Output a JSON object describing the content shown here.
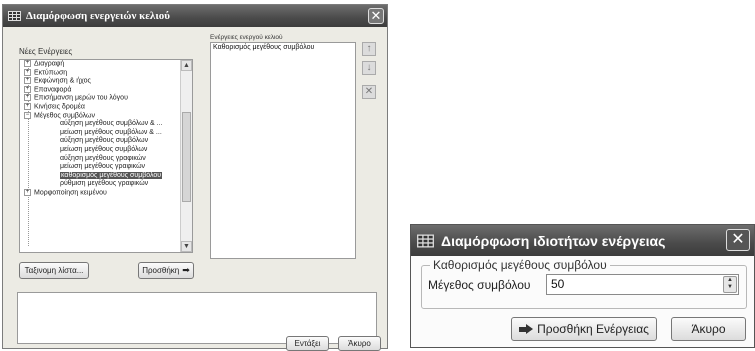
{
  "cell_actions_dialog": {
    "title": "Διαμόρφωση ενεργειών κελιού",
    "new_actions_label": "Νέες Ενέργειες",
    "tree_items": [
      {
        "label": "Διαγραφή",
        "level": 0
      },
      {
        "label": "Εκτύπωση",
        "level": 0
      },
      {
        "label": "Εκφώνηση & ήχος",
        "level": 0
      },
      {
        "label": "Επαναφορά",
        "level": 0
      },
      {
        "label": "Επισήμανση μερών του λόγου",
        "level": 0
      },
      {
        "label": "Κινήσεις δρομέα",
        "level": 0
      },
      {
        "label": "Μέγεθος συμβόλων",
        "level": 0
      },
      {
        "label": "αύξηση μεγέθους συμβόλων & ...",
        "level": 1
      },
      {
        "label": "μείωση μεγέθους συμβόλων & ...",
        "level": 1
      },
      {
        "label": "αύξηση μεγέθους συμβόλων",
        "level": 1
      },
      {
        "label": "μείωση μεγέθους συμβόλων",
        "level": 1
      },
      {
        "label": "αύξηση μεγέθους γραφικών",
        "level": 1
      },
      {
        "label": "μείωση μεγέθους γραφικών",
        "level": 1
      },
      {
        "label": "καθορισμός μεγέθους συμβόλου",
        "level": 1,
        "selected": true
      },
      {
        "label": "ρύθμιση μεγέθους γραφικών",
        "level": 1
      },
      {
        "label": "Μορφοποίηση κειμένου",
        "level": 0
      }
    ],
    "sort_button": "Ταξινομη λίστα...",
    "add_button": "Προσθήκη",
    "cell_actions_label": "Ενέργειες ενεργού κελιού",
    "cell_actions": [
      "Καθορισμός μεγέθους συμβόλου"
    ],
    "move_up_icon": "↑",
    "move_down_icon": "↓",
    "remove_icon": "✕",
    "ok_button": "Εντάξει",
    "cancel_button": "Άκυρο",
    "close_icon": "✕"
  },
  "action_props_dialog": {
    "title": "Διαμόρφωση ιδιοτήτων ενέργειας",
    "group_label": "Καθορισμός μεγέθους συμβόλου",
    "field_label": "Μέγεθος συμβόλου",
    "field_value": "50",
    "add_button": "Προσθήκη Ενέργειας",
    "cancel_button": "Άκυρο",
    "close_icon": "✕"
  }
}
